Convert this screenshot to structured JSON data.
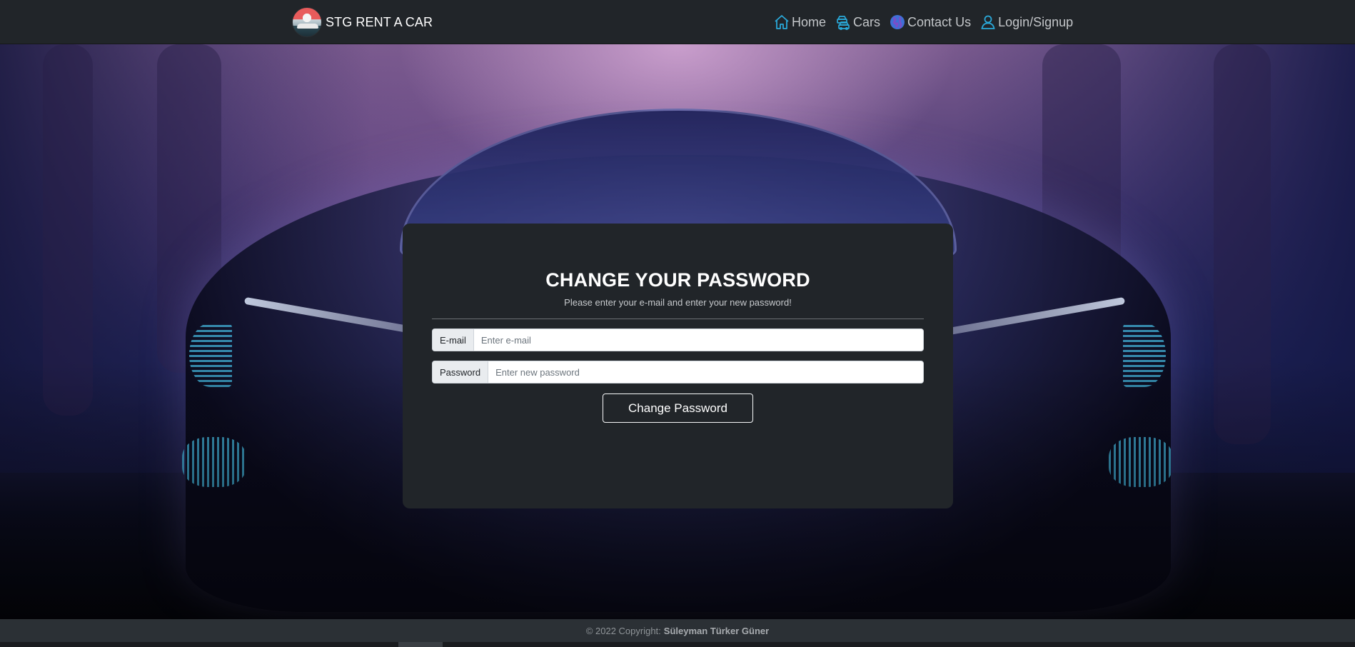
{
  "brand": {
    "name": "STG RENT A CAR",
    "logo_icon": "brand-logo-car-icon"
  },
  "nav": {
    "items": [
      {
        "label": "Home",
        "icon": "home-icon"
      },
      {
        "label": "Cars",
        "icon": "cars-icon"
      },
      {
        "label": "Contact Us",
        "icon": "contact-globe-icon"
      },
      {
        "label": "Login/Signup",
        "icon": "user-icon"
      }
    ]
  },
  "form": {
    "title": "CHANGE YOUR PASSWORD",
    "subtitle": "Please enter your e-mail and enter your new password!",
    "email_label": "E-mail",
    "email_placeholder": "Enter e-mail",
    "email_value": "",
    "password_label": "Password",
    "password_placeholder": "Enter new password",
    "password_value": "",
    "submit_label": "Change Password"
  },
  "footer": {
    "prefix": "© 2022 Copyright:",
    "author": "Süleyman Türker Güner"
  },
  "colors": {
    "navbar_bg": "#212529",
    "card_bg": "#212529",
    "nav_icon": "#2aa8d8",
    "footer_bg": "#2b3035"
  }
}
